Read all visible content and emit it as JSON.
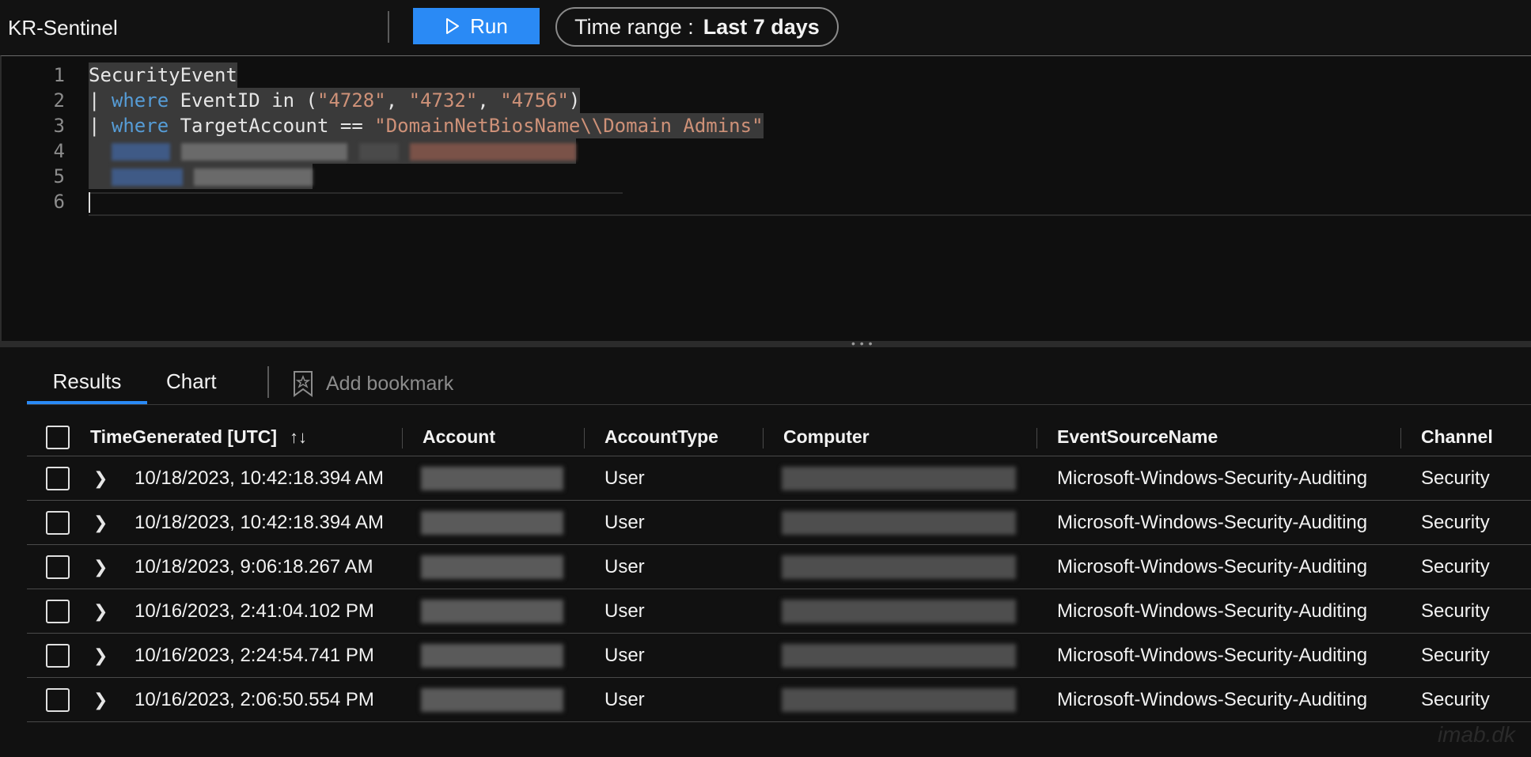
{
  "header": {
    "workspace": "KR-Sentinel",
    "run_label": "Run",
    "time_range_label": "Time range :",
    "time_range_value": "Last 7 days"
  },
  "editor": {
    "line_numbers": [
      "1",
      "2",
      "3",
      "4",
      "5",
      "6"
    ],
    "line1": {
      "plain": "SecurityEvent"
    },
    "line2": {
      "pipe": "| ",
      "kw": "where",
      "mid": " EventID in (",
      "s1": "\"4728\"",
      "c1": ", ",
      "s2": "\"4732\"",
      "c2": ", ",
      "s3": "\"4756\"",
      "end": ")"
    },
    "line3": {
      "pipe": "| ",
      "kw": "where",
      "mid": " TargetAccount == ",
      "s1": "\"DomainNetBiosName\\\\Domain Admins\""
    }
  },
  "results": {
    "tabs": [
      {
        "label": "Results",
        "active": true
      },
      {
        "label": "Chart",
        "active": false
      }
    ],
    "bookmark_label": "Add bookmark",
    "columns": [
      "TimeGenerated [UTC]",
      "Account",
      "AccountType",
      "Computer",
      "EventSourceName",
      "Channel"
    ],
    "sort_icon": "↑↓",
    "rows": [
      {
        "time": "10/18/2023, 10:42:18.394 AM",
        "account_type": "User",
        "event_source": "Microsoft-Windows-Security-Auditing",
        "channel": "Security"
      },
      {
        "time": "10/18/2023, 10:42:18.394 AM",
        "account_type": "User",
        "event_source": "Microsoft-Windows-Security-Auditing",
        "channel": "Security"
      },
      {
        "time": "10/18/2023, 9:06:18.267 AM",
        "account_type": "User",
        "event_source": "Microsoft-Windows-Security-Auditing",
        "channel": "Security"
      },
      {
        "time": "10/16/2023, 2:41:04.102 PM",
        "account_type": "User",
        "event_source": "Microsoft-Windows-Security-Auditing",
        "channel": "Security"
      },
      {
        "time": "10/16/2023, 2:24:54.741 PM",
        "account_type": "User",
        "event_source": "Microsoft-Windows-Security-Auditing",
        "channel": "Security"
      },
      {
        "time": "10/16/2023, 2:06:50.554 PM",
        "account_type": "User",
        "event_source": "Microsoft-Windows-Security-Auditing",
        "channel": "Security"
      }
    ]
  },
  "watermark": "imab.dk",
  "colors": {
    "accent": "#2a8af5",
    "keyword": "#569cd6",
    "string": "#ce9178",
    "background": "#121212"
  }
}
